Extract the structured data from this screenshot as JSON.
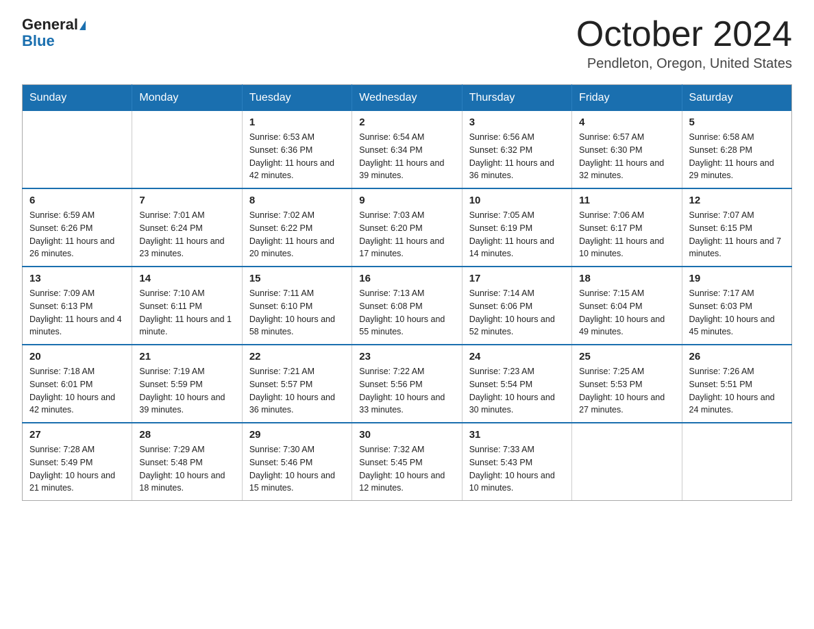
{
  "header": {
    "logo_general": "General",
    "logo_blue": "Blue",
    "month_title": "October 2024",
    "location": "Pendleton, Oregon, United States"
  },
  "days_of_week": [
    "Sunday",
    "Monday",
    "Tuesday",
    "Wednesday",
    "Thursday",
    "Friday",
    "Saturday"
  ],
  "weeks": [
    [
      {
        "day": "",
        "sunrise": "",
        "sunset": "",
        "daylight": ""
      },
      {
        "day": "",
        "sunrise": "",
        "sunset": "",
        "daylight": ""
      },
      {
        "day": "1",
        "sunrise": "Sunrise: 6:53 AM",
        "sunset": "Sunset: 6:36 PM",
        "daylight": "Daylight: 11 hours and 42 minutes."
      },
      {
        "day": "2",
        "sunrise": "Sunrise: 6:54 AM",
        "sunset": "Sunset: 6:34 PM",
        "daylight": "Daylight: 11 hours and 39 minutes."
      },
      {
        "day": "3",
        "sunrise": "Sunrise: 6:56 AM",
        "sunset": "Sunset: 6:32 PM",
        "daylight": "Daylight: 11 hours and 36 minutes."
      },
      {
        "day": "4",
        "sunrise": "Sunrise: 6:57 AM",
        "sunset": "Sunset: 6:30 PM",
        "daylight": "Daylight: 11 hours and 32 minutes."
      },
      {
        "day": "5",
        "sunrise": "Sunrise: 6:58 AM",
        "sunset": "Sunset: 6:28 PM",
        "daylight": "Daylight: 11 hours and 29 minutes."
      }
    ],
    [
      {
        "day": "6",
        "sunrise": "Sunrise: 6:59 AM",
        "sunset": "Sunset: 6:26 PM",
        "daylight": "Daylight: 11 hours and 26 minutes."
      },
      {
        "day": "7",
        "sunrise": "Sunrise: 7:01 AM",
        "sunset": "Sunset: 6:24 PM",
        "daylight": "Daylight: 11 hours and 23 minutes."
      },
      {
        "day": "8",
        "sunrise": "Sunrise: 7:02 AM",
        "sunset": "Sunset: 6:22 PM",
        "daylight": "Daylight: 11 hours and 20 minutes."
      },
      {
        "day": "9",
        "sunrise": "Sunrise: 7:03 AM",
        "sunset": "Sunset: 6:20 PM",
        "daylight": "Daylight: 11 hours and 17 minutes."
      },
      {
        "day": "10",
        "sunrise": "Sunrise: 7:05 AM",
        "sunset": "Sunset: 6:19 PM",
        "daylight": "Daylight: 11 hours and 14 minutes."
      },
      {
        "day": "11",
        "sunrise": "Sunrise: 7:06 AM",
        "sunset": "Sunset: 6:17 PM",
        "daylight": "Daylight: 11 hours and 10 minutes."
      },
      {
        "day": "12",
        "sunrise": "Sunrise: 7:07 AM",
        "sunset": "Sunset: 6:15 PM",
        "daylight": "Daylight: 11 hours and 7 minutes."
      }
    ],
    [
      {
        "day": "13",
        "sunrise": "Sunrise: 7:09 AM",
        "sunset": "Sunset: 6:13 PM",
        "daylight": "Daylight: 11 hours and 4 minutes."
      },
      {
        "day": "14",
        "sunrise": "Sunrise: 7:10 AM",
        "sunset": "Sunset: 6:11 PM",
        "daylight": "Daylight: 11 hours and 1 minute."
      },
      {
        "day": "15",
        "sunrise": "Sunrise: 7:11 AM",
        "sunset": "Sunset: 6:10 PM",
        "daylight": "Daylight: 10 hours and 58 minutes."
      },
      {
        "day": "16",
        "sunrise": "Sunrise: 7:13 AM",
        "sunset": "Sunset: 6:08 PM",
        "daylight": "Daylight: 10 hours and 55 minutes."
      },
      {
        "day": "17",
        "sunrise": "Sunrise: 7:14 AM",
        "sunset": "Sunset: 6:06 PM",
        "daylight": "Daylight: 10 hours and 52 minutes."
      },
      {
        "day": "18",
        "sunrise": "Sunrise: 7:15 AM",
        "sunset": "Sunset: 6:04 PM",
        "daylight": "Daylight: 10 hours and 49 minutes."
      },
      {
        "day": "19",
        "sunrise": "Sunrise: 7:17 AM",
        "sunset": "Sunset: 6:03 PM",
        "daylight": "Daylight: 10 hours and 45 minutes."
      }
    ],
    [
      {
        "day": "20",
        "sunrise": "Sunrise: 7:18 AM",
        "sunset": "Sunset: 6:01 PM",
        "daylight": "Daylight: 10 hours and 42 minutes."
      },
      {
        "day": "21",
        "sunrise": "Sunrise: 7:19 AM",
        "sunset": "Sunset: 5:59 PM",
        "daylight": "Daylight: 10 hours and 39 minutes."
      },
      {
        "day": "22",
        "sunrise": "Sunrise: 7:21 AM",
        "sunset": "Sunset: 5:57 PM",
        "daylight": "Daylight: 10 hours and 36 minutes."
      },
      {
        "day": "23",
        "sunrise": "Sunrise: 7:22 AM",
        "sunset": "Sunset: 5:56 PM",
        "daylight": "Daylight: 10 hours and 33 minutes."
      },
      {
        "day": "24",
        "sunrise": "Sunrise: 7:23 AM",
        "sunset": "Sunset: 5:54 PM",
        "daylight": "Daylight: 10 hours and 30 minutes."
      },
      {
        "day": "25",
        "sunrise": "Sunrise: 7:25 AM",
        "sunset": "Sunset: 5:53 PM",
        "daylight": "Daylight: 10 hours and 27 minutes."
      },
      {
        "day": "26",
        "sunrise": "Sunrise: 7:26 AM",
        "sunset": "Sunset: 5:51 PM",
        "daylight": "Daylight: 10 hours and 24 minutes."
      }
    ],
    [
      {
        "day": "27",
        "sunrise": "Sunrise: 7:28 AM",
        "sunset": "Sunset: 5:49 PM",
        "daylight": "Daylight: 10 hours and 21 minutes."
      },
      {
        "day": "28",
        "sunrise": "Sunrise: 7:29 AM",
        "sunset": "Sunset: 5:48 PM",
        "daylight": "Daylight: 10 hours and 18 minutes."
      },
      {
        "day": "29",
        "sunrise": "Sunrise: 7:30 AM",
        "sunset": "Sunset: 5:46 PM",
        "daylight": "Daylight: 10 hours and 15 minutes."
      },
      {
        "day": "30",
        "sunrise": "Sunrise: 7:32 AM",
        "sunset": "Sunset: 5:45 PM",
        "daylight": "Daylight: 10 hours and 12 minutes."
      },
      {
        "day": "31",
        "sunrise": "Sunrise: 7:33 AM",
        "sunset": "Sunset: 5:43 PM",
        "daylight": "Daylight: 10 hours and 10 minutes."
      },
      {
        "day": "",
        "sunrise": "",
        "sunset": "",
        "daylight": ""
      },
      {
        "day": "",
        "sunrise": "",
        "sunset": "",
        "daylight": ""
      }
    ]
  ]
}
